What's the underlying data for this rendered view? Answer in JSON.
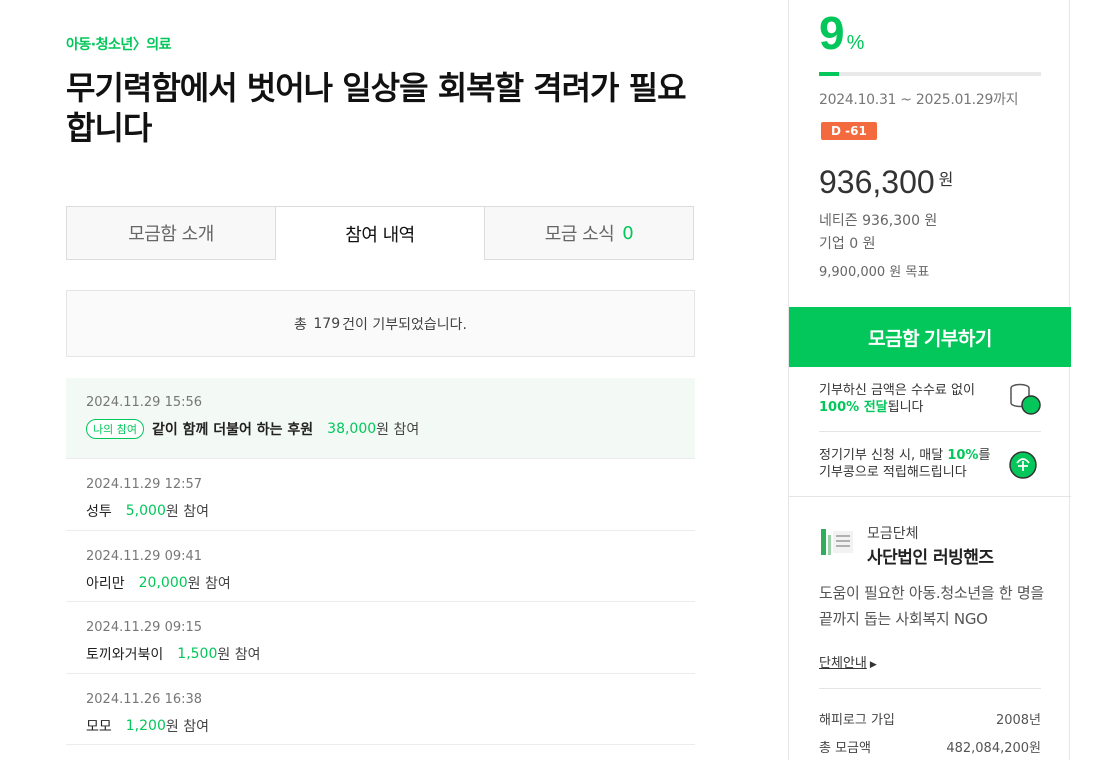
{
  "breadcrumb": {
    "category": "아동·청소년",
    "separator": "〉",
    "subcategory": "의료"
  },
  "title": "무기력함에서 벗어나 일상을 회복할 격려가 필요합니다",
  "tabs": [
    {
      "label": "모금함 소개",
      "count": ""
    },
    {
      "label": "참여 내역",
      "count": ""
    },
    {
      "label": "모금 소식",
      "count": "0"
    }
  ],
  "summary": {
    "prefix": "총",
    "count": "179",
    "suffix": "건이 기부되었습니다."
  },
  "donations": [
    {
      "date": "2024.11.29 15:56",
      "badge": "나의 참여",
      "name": "같이 함께 더불어 하는 후원",
      "amount": "38,000",
      "unit": "원 참여",
      "mine": true
    },
    {
      "date": "2024.11.29 12:57",
      "name": "성투",
      "amount": "5,000",
      "unit": "원 참여"
    },
    {
      "date": "2024.11.29 09:41",
      "name": "아리만",
      "amount": "20,000",
      "unit": "원 참여"
    },
    {
      "date": "2024.11.29 09:15",
      "name": "토끼와거북이",
      "amount": "1,500",
      "unit": "원 참여"
    },
    {
      "date": "2024.11.26 16:38",
      "name": "모모",
      "amount": "1,200",
      "unit": "원 참여"
    }
  ],
  "campaign": {
    "percent": "9",
    "percent_sign": "%",
    "progress_percent": 9,
    "period": "2024.10.31 ~ 2025.01.29까지",
    "dday": "D -61",
    "raised": "936,300",
    "raised_unit": "원",
    "netizen": "네티즌 936,300 원",
    "company": "기업 0 원",
    "goal": "9,900,000 원 목표",
    "donate_button": "모금함 기부하기"
  },
  "info": {
    "fee_line1": "기부하신 금액은 수수료 없이",
    "fee_bold": "100% 전달",
    "fee_line2": "됩니다",
    "regular_line1a": "정기기부 신청 시, 매달 ",
    "regular_bold": "10%",
    "regular_line1b": "를",
    "regular_line2": "기부콩으로 적립해드립니다"
  },
  "org": {
    "label": "모금단체",
    "name": "사단법인 러빙핸즈",
    "description": "도움이 필요한 아동.청소년을 한 명을 끝까지 돕는 사회복지 NGO",
    "link": "단체안내",
    "stats": [
      {
        "label": "해피로그 가입",
        "value": "2008년"
      },
      {
        "label": "총 모금액",
        "value": "482,084,200원"
      }
    ]
  },
  "colors": {
    "accent": "#03c75a",
    "dday": "#f26a3d"
  }
}
